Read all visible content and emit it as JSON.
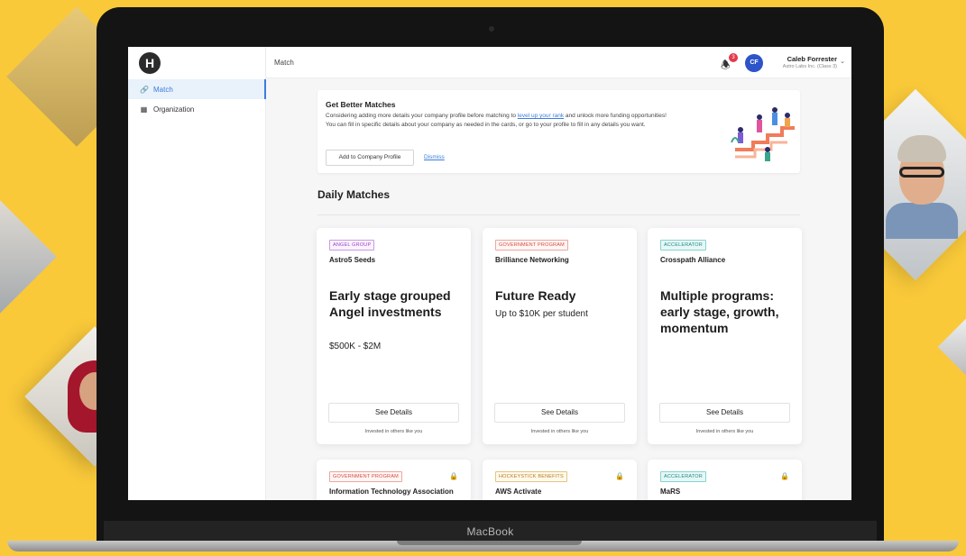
{
  "laptop": {
    "brand": "MacBook"
  },
  "app": {
    "logo_letter": "H",
    "page_title": "Match"
  },
  "sidebar": {
    "items": [
      {
        "label": "Match",
        "icon": "link-icon",
        "active": true
      },
      {
        "label": "Organization",
        "icon": "building-icon",
        "active": false
      }
    ]
  },
  "header": {
    "notification_count": "3",
    "avatar_initials": "CF",
    "user_name": "Caleb Forrester",
    "user_org": "Astro Labs Inc. (Class 3)"
  },
  "banner": {
    "title": "Get Better Matches",
    "body_part1": "Considering adding more details your company profile before matching to ",
    "body_link": "level up your rank",
    "body_part2": " and unlock more funding opportunities! You can fill in specific details about your company as needed in the cards, or go to your profile to fill in any details you want.",
    "add_button": "Add to Company Profile",
    "dismiss_link": "Dismiss"
  },
  "daily_matches": {
    "title": "Daily Matches",
    "cards": [
      {
        "tag": "ANGEL GROUP",
        "org": "Astro5 Seeds",
        "title": "Early stage grouped Angel investments",
        "subtitle": "$500K - $2M",
        "button": "See Details",
        "footer": "Invested in others like you"
      },
      {
        "tag": "GOVERNMENT PROGRAM",
        "org": "Brilliance Networking",
        "title": "Future Ready",
        "subtitle": "Up to $10K per student",
        "button": "See Details",
        "footer": "Invested in others like you"
      },
      {
        "tag": "ACCELERATOR",
        "org": "Crosspath Alliance",
        "title": "Multiple programs: early stage, growth, momentum",
        "subtitle": "",
        "button": "See Details",
        "footer": "Invested in others like you"
      }
    ],
    "locked_cards": [
      {
        "tag": "GOVERNMENT PROGRAM",
        "org": "Information Technology Association",
        "icon": "lock-icon"
      },
      {
        "tag": "HOCKEYSTICK BENEFITS",
        "org": "AWS Activate",
        "icon": "lock-icon"
      },
      {
        "tag": "ACCELERATOR",
        "org": "MaRS",
        "icon": "lock-icon"
      }
    ]
  },
  "colors": {
    "background": "#f9c93a",
    "accent": "#3b7ddd",
    "avatar": "#2d54c8",
    "badge": "#e23a4c"
  }
}
